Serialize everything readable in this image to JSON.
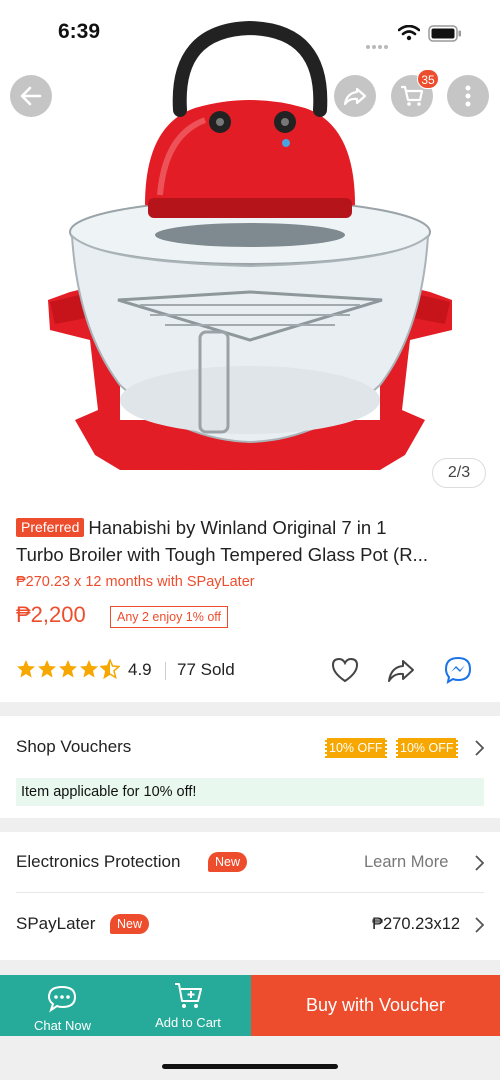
{
  "status_bar": {
    "time": "6:39"
  },
  "header": {
    "cart_count": "35"
  },
  "gallery": {
    "counter": "2/3"
  },
  "product": {
    "badge": "Preferred",
    "title_line1": "Hanabishi by Winland Original 7 in 1",
    "title_line2": "Turbo Broiler with Tough Tempered Glass Pot  (R...",
    "installment": "₱270.23 x 12 months with SPayLater",
    "price": "₱2,200",
    "promo": "Any 2 enjoy 1% off",
    "rating": "4.9",
    "rating_value": 4.5,
    "sold": "77 Sold"
  },
  "vouchers": {
    "label": "Shop Vouchers",
    "chips": [
      "10% OFF",
      "10% OFF"
    ],
    "note": "Item applicable for 10% off!"
  },
  "protection": {
    "label": "Electronics Protection",
    "badge": "New",
    "action": "Learn More"
  },
  "spaylater": {
    "label": "SPayLater",
    "badge": "New",
    "value": "₱270.23x12"
  },
  "bottom_bar": {
    "chat": "Chat Now",
    "add_to_cart": "Add to Cart",
    "buy": "Buy with Voucher"
  },
  "colors": {
    "brand": "#ee4d2d",
    "teal": "#26aa99",
    "star": "#f6a700",
    "messenger": "#1a73e8"
  }
}
